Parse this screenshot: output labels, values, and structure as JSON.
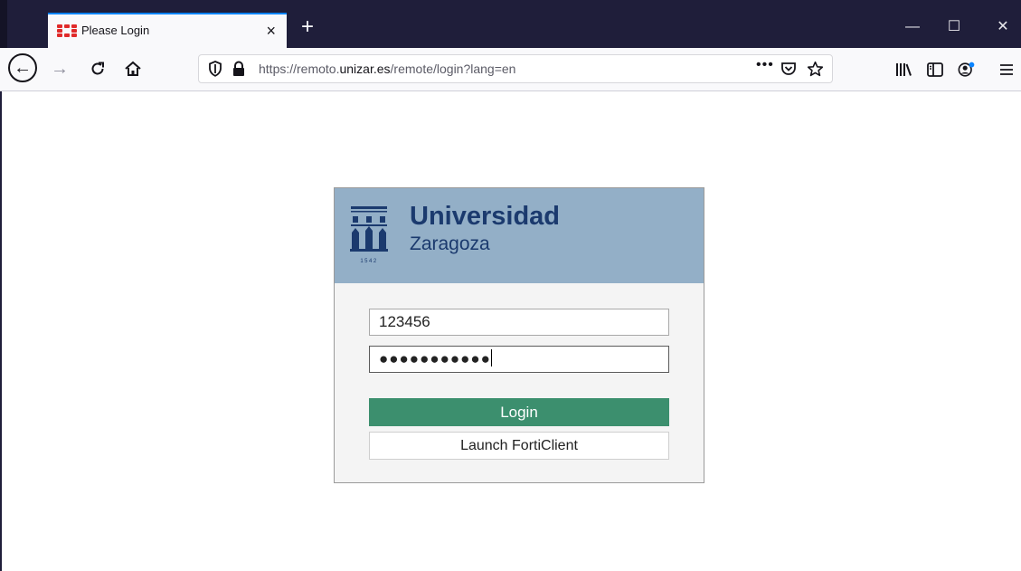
{
  "browser": {
    "tab": {
      "title": "Please Login",
      "close_glyph": "×"
    },
    "new_tab_glyph": "+",
    "window_controls": {
      "minimize": "—",
      "maximize": "☐",
      "close": "✕"
    },
    "nav": {
      "back": "←",
      "forward": "→",
      "reload": "C",
      "home": "⌂"
    },
    "url": {
      "prefix": "https://remoto.",
      "domain": "unizar.es",
      "path": "/remote/login?lang=en"
    },
    "url_actions": {
      "more": "•••"
    },
    "icons": [
      "shield-icon",
      "lock-icon",
      "pocket-icon",
      "bookmark-star-icon",
      "library-icon",
      "sidebar-icon",
      "account-icon",
      "menu-icon"
    ]
  },
  "page": {
    "brand": {
      "line1": "Universidad",
      "line2": "Zaragoza",
      "year": "1542"
    },
    "form": {
      "username_value": "123456",
      "password_value": "●●●●●●●●●●●",
      "login_label": "Login",
      "launch_label": "Launch FortiClient"
    }
  },
  "colors": {
    "titlebar": "#1f1e3a",
    "banner": "#93afc7",
    "brand_text": "#1b3a6e",
    "login_button": "#3c8f6e",
    "favicon": "#e02a2a"
  }
}
